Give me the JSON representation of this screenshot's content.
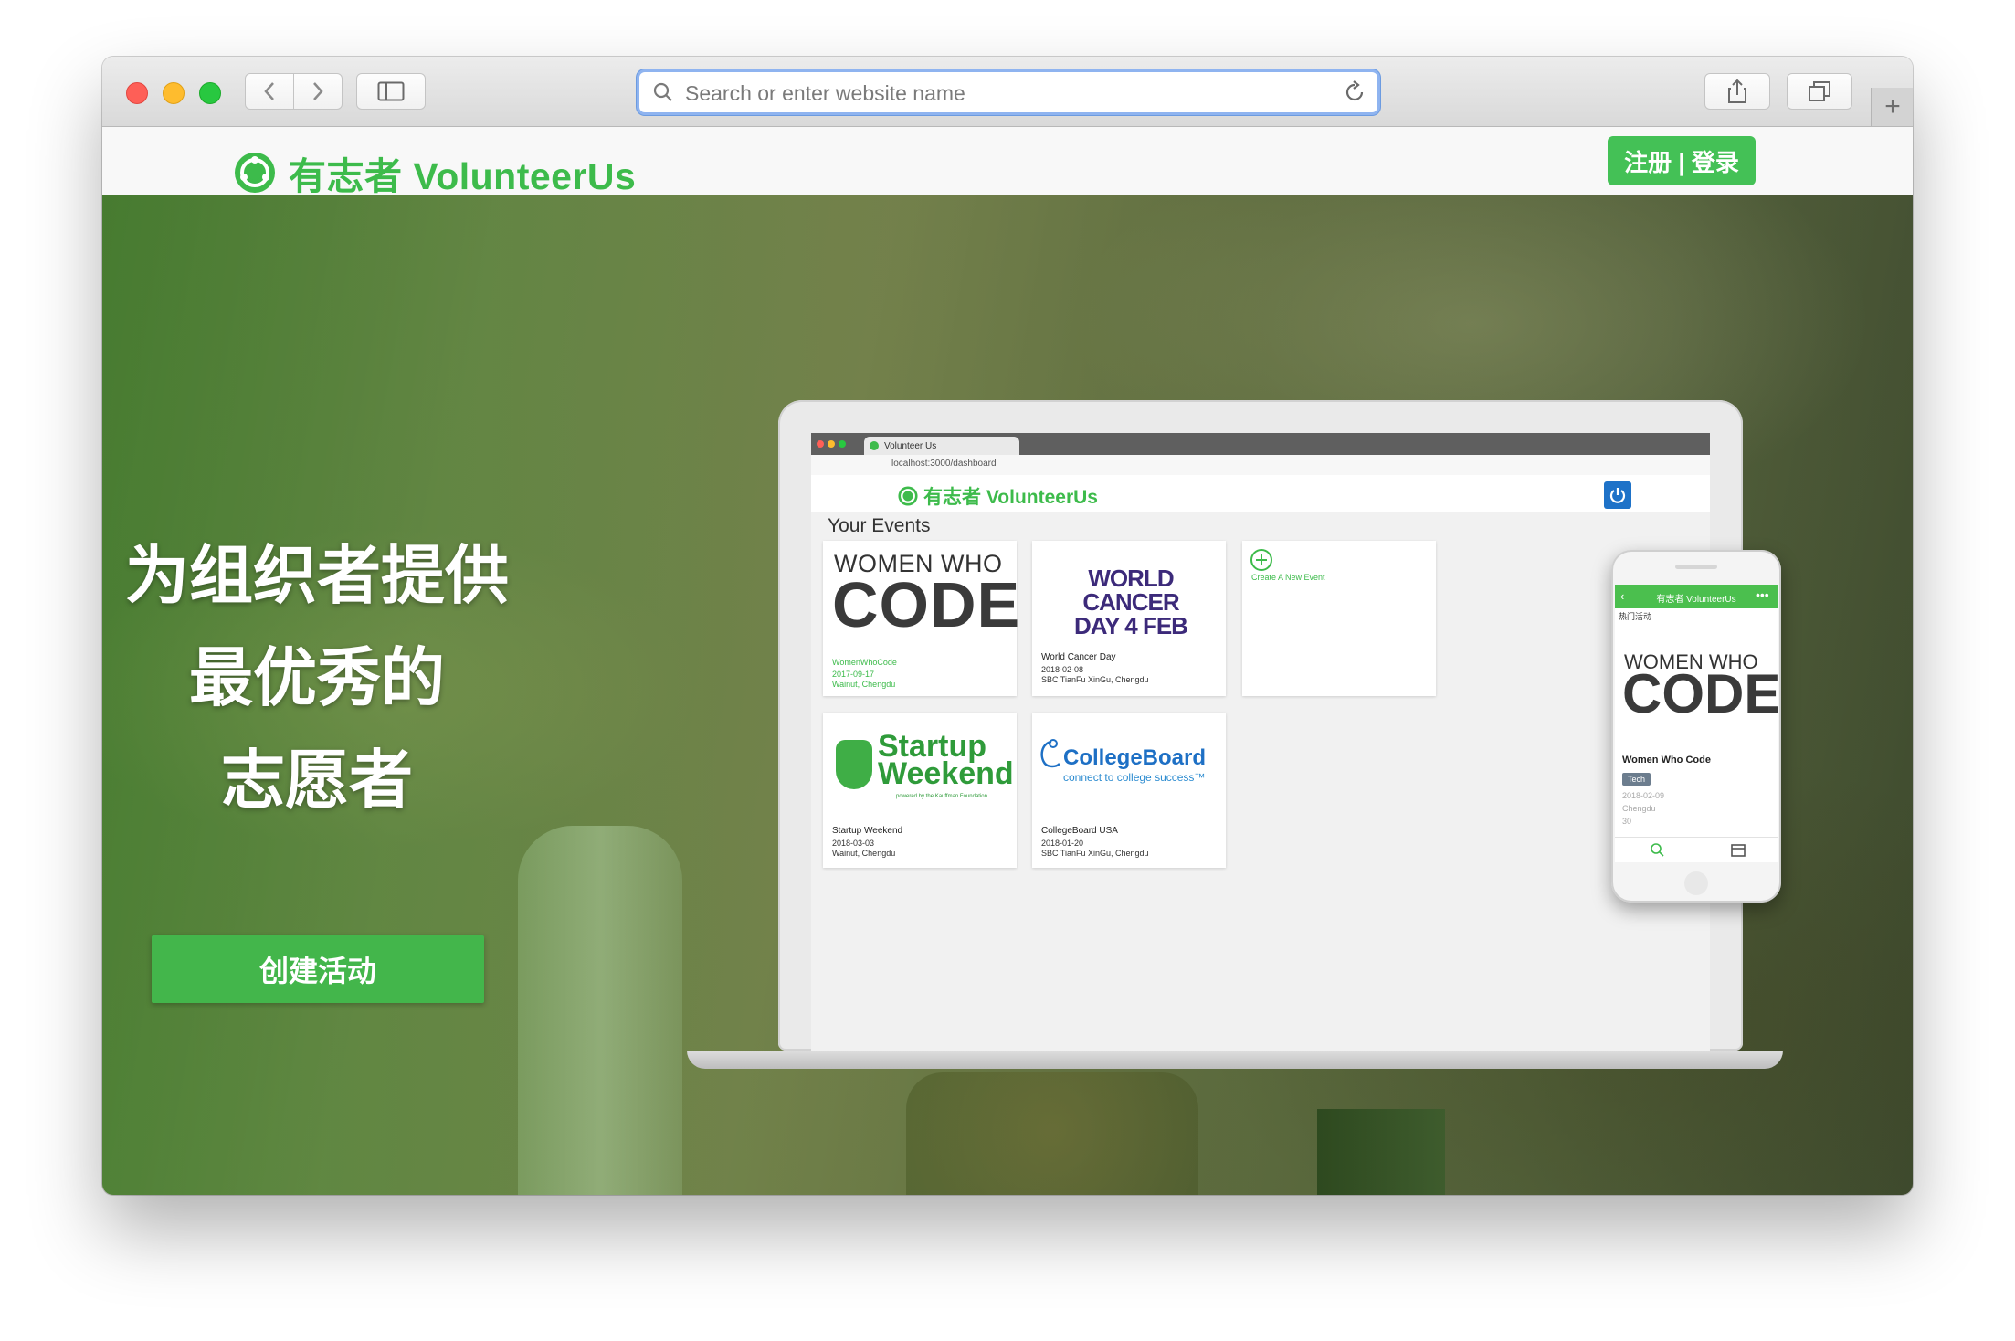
{
  "browser": {
    "address_placeholder": "Search or enter website name"
  },
  "site": {
    "brand": "有志者 VolunteerUs",
    "auth_button": "注册 | 登录"
  },
  "hero": {
    "title_lines": [
      "为组织者提供",
      "最优秀的",
      "志愿者"
    ],
    "create_button": "创建活动"
  },
  "laptop_app": {
    "tab_title": "Volunteer Us",
    "url": "localhost:3000/dashboard",
    "brand": "有志者 VolunteerUs",
    "section_title": "Your Events",
    "create_event": "Create A New Event",
    "events": [
      {
        "logo_top": "WOMEN WHO",
        "logo_main": "CODE",
        "name": "WomenWhoCode",
        "date": "2017-09-17",
        "location": "Wainut, Chengdu"
      },
      {
        "logo_line1": "WORLD CANCER",
        "logo_line2": "DAY 4 FEB",
        "name": "World Cancer Day",
        "date": "2018-02-08",
        "location": "SBC TianFu XinGu, Chengdu"
      },
      {
        "logo_line1": "Startup",
        "logo_line2": "Weekend",
        "logo_sub": "powered by the Kauffman Foundation",
        "name": "Startup Weekend",
        "date": "2018-03-03",
        "location": "Wainut, Chengdu"
      },
      {
        "logo_line1": "CollegeBoard",
        "logo_sub": "connect to college success™",
        "name": "CollegeBoard USA",
        "date": "2018-01-20",
        "location": "SBC TianFu XinGu, Chengdu"
      }
    ]
  },
  "phone_app": {
    "nav_title": "有志者 VolunteerUs",
    "section": "热门活动",
    "logo_top": "WOMEN WHO",
    "logo_main": "CODE",
    "event_title": "Women Who Code",
    "tag": "Tech",
    "date": "2018-02-09",
    "location": "Chengdu",
    "count": "30"
  },
  "colors": {
    "brand_green": "#3dbb4b",
    "button_green": "#43b64b",
    "address_focus": "#8fb4f0"
  }
}
